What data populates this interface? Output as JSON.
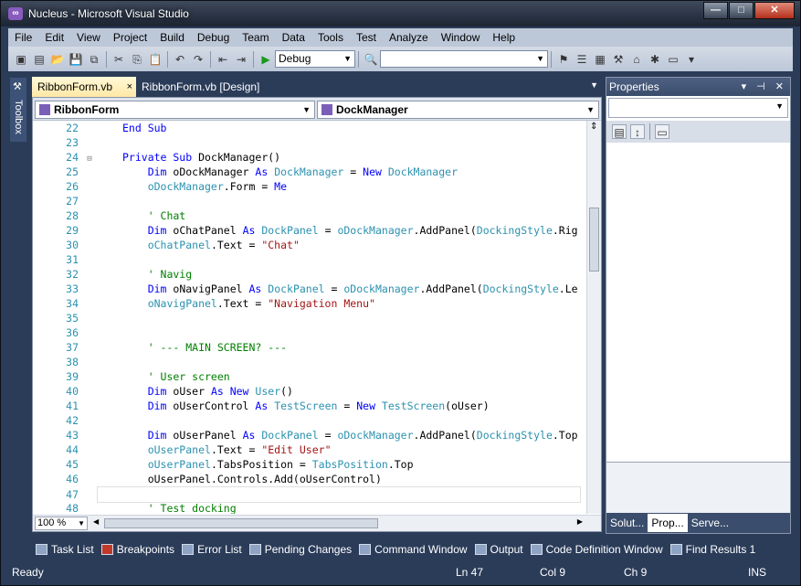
{
  "window": {
    "title": "Nucleus - Microsoft Visual Studio",
    "minimize": "—",
    "maximize": "□",
    "close": "✕"
  },
  "menu": [
    "File",
    "Edit",
    "View",
    "Project",
    "Build",
    "Debug",
    "Team",
    "Data",
    "Tools",
    "Test",
    "Analyze",
    "Window",
    "Help"
  ],
  "toolbar": {
    "configuration": "Debug",
    "search_value": ""
  },
  "toolbox_label": "Toolbox",
  "doc_tabs": {
    "active": "RibbonForm.vb",
    "inactive": "RibbonForm.vb [Design]",
    "close": "×"
  },
  "nav": {
    "class_combo": "RibbonForm",
    "member_combo": "DockManager"
  },
  "code_lines": [
    {
      "n": "22",
      "g": "",
      "segs": [
        [
          "kw",
          "End Sub"
        ]
      ]
    },
    {
      "n": "23",
      "g": "",
      "segs": []
    },
    {
      "n": "24",
      "g": "⊟",
      "segs": [
        [
          "kw",
          "Private Sub "
        ],
        [
          "",
          "DockManager()"
        ]
      ]
    },
    {
      "n": "25",
      "g": "",
      "segs": [
        [
          "kw",
          "    Dim "
        ],
        [
          "",
          "oDockManager "
        ],
        [
          "kw",
          "As "
        ],
        [
          "ty",
          "DockManager"
        ],
        [
          "",
          " = "
        ],
        [
          "kw",
          "New "
        ],
        [
          "ty",
          "DockManager"
        ]
      ]
    },
    {
      "n": "26",
      "g": "",
      "segs": [
        [
          "ty",
          "    oDockManager"
        ],
        [
          "",
          ".Form = "
        ],
        [
          "kw",
          "Me"
        ]
      ]
    },
    {
      "n": "27",
      "g": "",
      "segs": []
    },
    {
      "n": "28",
      "g": "",
      "segs": [
        [
          "cm",
          "    ' Chat"
        ]
      ]
    },
    {
      "n": "29",
      "g": "",
      "segs": [
        [
          "kw",
          "    Dim "
        ],
        [
          "",
          "oChatPanel "
        ],
        [
          "kw",
          "As "
        ],
        [
          "ty",
          "DockPanel"
        ],
        [
          "",
          " = "
        ],
        [
          "ty",
          "oDockManager"
        ],
        [
          "",
          ".AddPanel("
        ],
        [
          "ty",
          "DockingStyle"
        ],
        [
          "",
          ".Rig"
        ]
      ]
    },
    {
      "n": "30",
      "g": "",
      "segs": [
        [
          "ty",
          "    oChatPanel"
        ],
        [
          "",
          ".Text = "
        ],
        [
          "st",
          "\"Chat\""
        ]
      ]
    },
    {
      "n": "31",
      "g": "",
      "segs": []
    },
    {
      "n": "32",
      "g": "",
      "segs": [
        [
          "cm",
          "    ' Navig"
        ]
      ]
    },
    {
      "n": "33",
      "g": "",
      "segs": [
        [
          "kw",
          "    Dim "
        ],
        [
          "",
          "oNavigPanel "
        ],
        [
          "kw",
          "As "
        ],
        [
          "ty",
          "DockPanel"
        ],
        [
          "",
          " = "
        ],
        [
          "ty",
          "oDockManager"
        ],
        [
          "",
          ".AddPanel("
        ],
        [
          "ty",
          "DockingStyle"
        ],
        [
          "",
          ".Le"
        ]
      ]
    },
    {
      "n": "34",
      "g": "",
      "segs": [
        [
          "ty",
          "    oNavigPanel"
        ],
        [
          "",
          ".Text = "
        ],
        [
          "st",
          "\"Navigation Menu\""
        ]
      ]
    },
    {
      "n": "35",
      "g": "",
      "segs": []
    },
    {
      "n": "36",
      "g": "",
      "segs": []
    },
    {
      "n": "37",
      "g": "",
      "segs": [
        [
          "cm",
          "    ' --- MAIN SCREEN? ---"
        ]
      ]
    },
    {
      "n": "38",
      "g": "",
      "segs": []
    },
    {
      "n": "39",
      "g": "",
      "segs": [
        [
          "cm",
          "    ' User screen"
        ]
      ]
    },
    {
      "n": "40",
      "g": "",
      "segs": [
        [
          "kw",
          "    Dim "
        ],
        [
          "",
          "oUser "
        ],
        [
          "kw",
          "As New "
        ],
        [
          "ty",
          "User"
        ],
        [
          "",
          "()"
        ]
      ]
    },
    {
      "n": "41",
      "g": "",
      "segs": [
        [
          "kw",
          "    Dim "
        ],
        [
          "",
          "oUserControl "
        ],
        [
          "kw",
          "As "
        ],
        [
          "ty",
          "TestScreen"
        ],
        [
          "",
          " = "
        ],
        [
          "kw",
          "New "
        ],
        [
          "ty",
          "TestScreen"
        ],
        [
          "",
          "(oUser)"
        ]
      ]
    },
    {
      "n": "42",
      "g": "",
      "segs": []
    },
    {
      "n": "43",
      "g": "",
      "segs": [
        [
          "kw",
          "    Dim "
        ],
        [
          "",
          "oUserPanel "
        ],
        [
          "kw",
          "As "
        ],
        [
          "ty",
          "DockPanel"
        ],
        [
          "",
          " = "
        ],
        [
          "ty",
          "oDockManager"
        ],
        [
          "",
          ".AddPanel("
        ],
        [
          "ty",
          "DockingStyle"
        ],
        [
          "",
          ".Top"
        ]
      ]
    },
    {
      "n": "44",
      "g": "",
      "segs": [
        [
          "ty",
          "    oUserPanel"
        ],
        [
          "",
          ".Text = "
        ],
        [
          "st",
          "\"Edit User\""
        ]
      ]
    },
    {
      "n": "45",
      "g": "",
      "segs": [
        [
          "ty",
          "    oUserPanel"
        ],
        [
          "",
          ".TabsPosition = "
        ],
        [
          "ty",
          "TabsPosition"
        ],
        [
          "",
          ".Top"
        ]
      ]
    },
    {
      "n": "46",
      "g": "",
      "segs": [
        [
          "",
          "    oUserPanel.Controls.Add(oUserControl)"
        ]
      ]
    },
    {
      "n": "47",
      "g": "",
      "segs": [],
      "current": true
    },
    {
      "n": "48",
      "g": "",
      "segs": [
        [
          "cm",
          "    ' Test docking"
        ]
      ]
    }
  ],
  "editor": {
    "zoom": "100 %"
  },
  "properties": {
    "title": "Properties",
    "title_btns": "▾ ⊣ ✕",
    "tabs": [
      "Solut...",
      "Prop...",
      "Serve..."
    ]
  },
  "bottom_tabs": [
    "Task List",
    "Breakpoints",
    "Error List",
    "Pending Changes",
    "Command Window",
    "Output",
    "Code Definition Window",
    "Find Results 1"
  ],
  "status": {
    "ready": "Ready",
    "line": "Ln 47",
    "col": "Col 9",
    "ch": "Ch 9",
    "mode": "INS"
  },
  "colors": {
    "keyword": "#0000ff",
    "type": "#2b91af",
    "string": "#a31515",
    "comment": "#008000",
    "chrome": "#2b3c59"
  }
}
